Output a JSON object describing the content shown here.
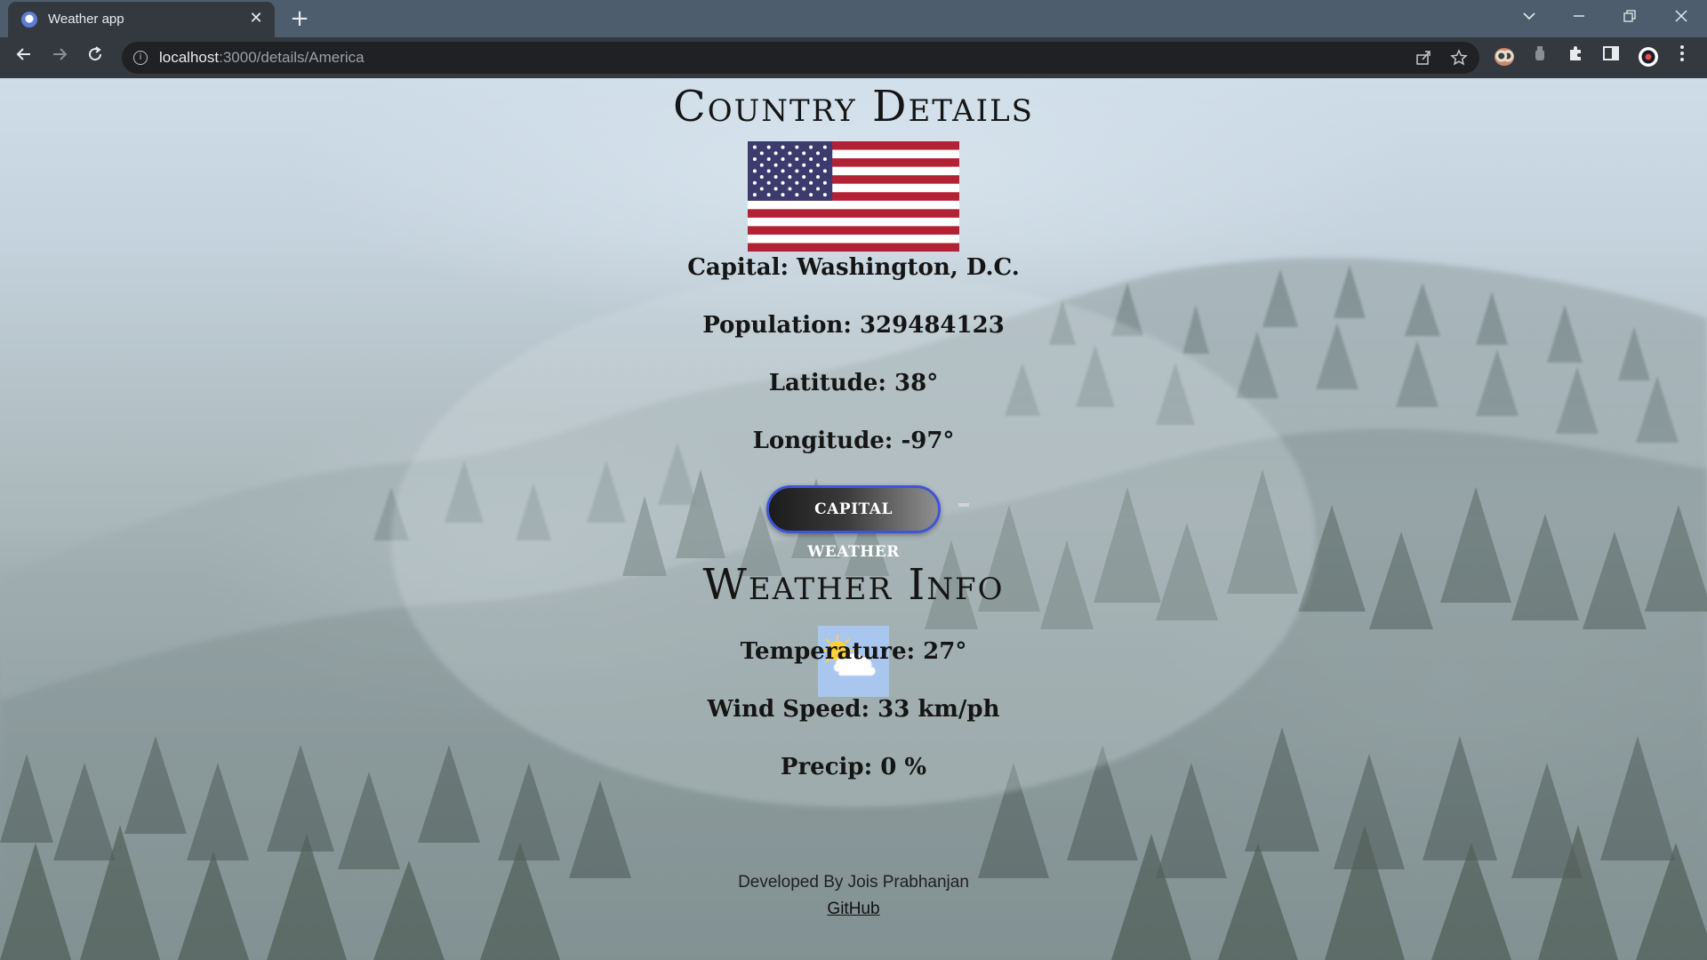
{
  "browser": {
    "tab_title": "Weather app",
    "close_glyph": "✕",
    "new_tab_glyph": "+",
    "url_host": "localhost",
    "url_path": ":3000/details/America",
    "info_glyph": "i"
  },
  "page": {
    "country_heading": "Country Details",
    "capital": "Capital: Washington, D.C.",
    "population": "Population: 329484123",
    "latitude": "Latitude: 38°",
    "longitude": "Longitude: -97°",
    "capital_weather_button": "CAPITAL WEATHER",
    "weather_heading": "Weather Info",
    "temperature": "Temperature: 27°",
    "wind_speed": "Wind Speed: 33 km/ph",
    "precip": "Precip: 0 %",
    "developer_credit": "Developed By Jois Prabhanjan",
    "github_link": "GitHub"
  },
  "icons": {
    "flag": "us-flag-image",
    "weather": "partly-cloudy-icon"
  },
  "colors": {
    "button_border": "#3f54d6",
    "flag_red": "#b22234",
    "flag_blue": "#3c3b6e"
  }
}
